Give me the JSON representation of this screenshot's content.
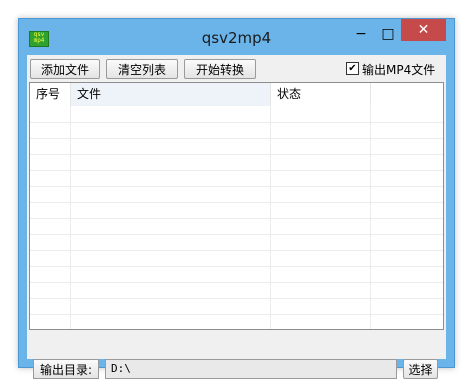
{
  "window": {
    "title": "qsv2mp4",
    "icon_text_top": "qsv",
    "icon_text_bottom": "mp4",
    "minimize_glyph": "−",
    "maximize_glyph": "□",
    "close_glyph": "✕"
  },
  "toolbar": {
    "add_files_label": "添加文件",
    "clear_list_label": "清空列表",
    "start_convert_label": "开始转换",
    "output_mp4_label": "输出MP4文件",
    "output_mp4_checked": true,
    "check_glyph": "✔"
  },
  "list": {
    "columns": [
      "序号",
      "文件",
      "状态",
      ""
    ],
    "rows": []
  },
  "output": {
    "dir_label": "输出目录:",
    "dir_value": "D:\\",
    "choose_label": "选择"
  },
  "colors": {
    "titlebar": "#6ab4ea",
    "close_button": "#c74a4a",
    "client_bg": "#f0f0f0",
    "header_highlight": "#edf3f9"
  }
}
